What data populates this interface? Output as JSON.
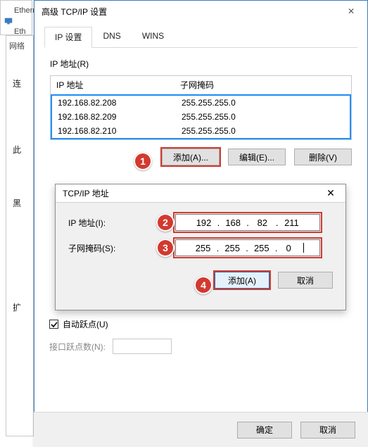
{
  "background": {
    "tab_a": "Ethern",
    "tab_b": "Eth",
    "panel_b_label": "网络",
    "side1": "连",
    "side2": "此",
    "side3": "黑",
    "side4": "扩"
  },
  "dialog": {
    "title": "高级 TCP/IP 设置",
    "tabs": [
      "IP 设置",
      "DNS",
      "WINS"
    ],
    "active_tab": 0,
    "close_glyph": "✕"
  },
  "ip_group": {
    "label": "IP 地址(R)",
    "cols": {
      "c1": "IP 地址",
      "c2": "子网掩码"
    },
    "rows": [
      {
        "ip": "192.168.82.208",
        "mask": "255.255.255.0"
      },
      {
        "ip": "192.168.82.209",
        "mask": "255.255.255.0"
      },
      {
        "ip": "192.168.82.210",
        "mask": "255.255.255.0"
      }
    ],
    "buttons": {
      "add": "添加(A)...",
      "edit": "编辑(E)...",
      "remove": "删除(V)"
    }
  },
  "inner": {
    "title": "TCP/IP 地址",
    "close_glyph": "✕",
    "ip_label": "IP 地址(I):",
    "mask_label": "子网掩码(S):",
    "ip_octets": [
      "192",
      "168",
      "82",
      "211"
    ],
    "mask_octets": [
      "255",
      "255",
      "255",
      "0"
    ],
    "buttons": {
      "add": "添加(A)",
      "cancel": "取消"
    }
  },
  "auto": {
    "checkbox_label": "自动跃点(U)",
    "checked": true,
    "metric_label": "接口跃点数(N):"
  },
  "footer": {
    "ok": "确定",
    "cancel": "取消"
  },
  "callouts": {
    "n1": "1",
    "n2": "2",
    "n3": "3",
    "n4": "4"
  },
  "colors": {
    "accent_red": "#d23a2f",
    "list_blue": "#1e90ff"
  }
}
